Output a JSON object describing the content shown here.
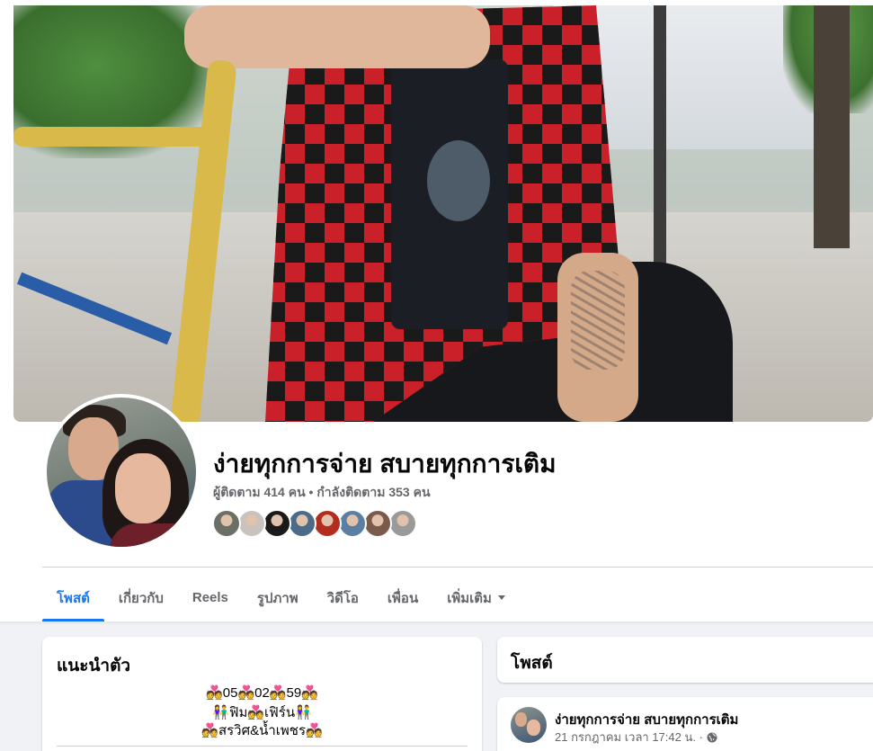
{
  "profile": {
    "name": "ง่ายทุกการจ่าย สบายทุกการเติม",
    "follow_stats": "ผู้ติดตาม 414 คน • กำลังติดตาม 353 คน",
    "follower_avatar_colors": [
      "#6b6f66",
      "#c9c3bd",
      "#1a1a1a",
      "#4a6b8a",
      "#b32d1f",
      "#5a7fa3",
      "#7a5a4a",
      "#9a9a9a"
    ]
  },
  "tabs": [
    {
      "label": "โพสต์",
      "active": true
    },
    {
      "label": "เกี่ยวกับ",
      "active": false
    },
    {
      "label": "Reels",
      "active": false
    },
    {
      "label": "รูปภาพ",
      "active": false
    },
    {
      "label": "วิดีโอ",
      "active": false
    },
    {
      "label": "เพื่อน",
      "active": false
    },
    {
      "label": "เพิ่มเติม",
      "active": false
    }
  ],
  "intro": {
    "title": "แนะนำตัว",
    "bio": [
      "💑05💑02💑59💑",
      "👫ฟิม💑เฟิร์น👫",
      "💑สรวิศ&น้ำเพชร💑"
    ]
  },
  "posts": {
    "title": "โพสต์",
    "first_post": {
      "author": "ง่ายทุกการจ่าย สบายทุกการเติม",
      "meta": "21 กรกฎาคม เวลา 17:42 น. ·",
      "privacy_icon": "globe-icon"
    }
  },
  "colors": {
    "accent": "#1877f2",
    "secondary_text": "#65676b",
    "page_background": "#f0f2f5"
  }
}
